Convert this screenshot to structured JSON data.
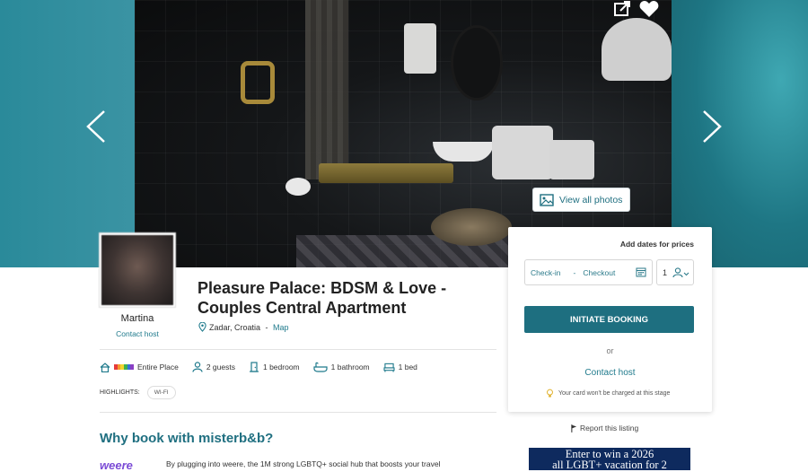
{
  "hero": {
    "view_photos_label": "View all photos",
    "share_icon": "share-icon",
    "favorite_icon": "heart-icon",
    "prev_icon": "chevron-left-icon",
    "next_icon": "chevron-right-icon"
  },
  "host": {
    "name": "Martina",
    "contact_label": "Contact host"
  },
  "listing": {
    "title": "Pleasure Palace: BDSM & Love - Couples Central Apartment",
    "location": "Zadar, Croatia",
    "separator": " - ",
    "map_label": "Map",
    "features": [
      {
        "icon": "home-icon",
        "label": "Entire Place"
      },
      {
        "icon": "guests-icon",
        "label": "2 guests"
      },
      {
        "icon": "door-icon",
        "label": "1 bedroom"
      },
      {
        "icon": "bathtub-icon",
        "label": "1 bathroom"
      },
      {
        "icon": "bed-icon",
        "label": "1 bed"
      }
    ],
    "highlights_label": "HIGHLIGHTS:",
    "highlights": [
      "WI-FI"
    ]
  },
  "booking": {
    "add_dates_label": "Add dates for prices",
    "checkin_label": "Check-in",
    "dash": "-",
    "checkout_label": "Checkout",
    "guests_value": "1",
    "initiate_label": "INITIATE BOOKING",
    "or_label": "or",
    "contact_label": "Contact host",
    "note": "Your card won't be charged at this stage"
  },
  "report_label": "Report this listing",
  "ad": {
    "line1": "Enter to win a 2026",
    "line2": "all LGBT+ vacation for 2"
  },
  "why": {
    "title": "Why book with misterb&b?",
    "logo": "weere",
    "text": "By plugging into weere, the 1M strong LGBTQ+ social hub that boosts your travel"
  },
  "colors": {
    "accent": "#1e6f80",
    "link": "#1f7a8c",
    "hero_bg": "#2f8b9a",
    "ad_bg": "#0e2a5e"
  }
}
